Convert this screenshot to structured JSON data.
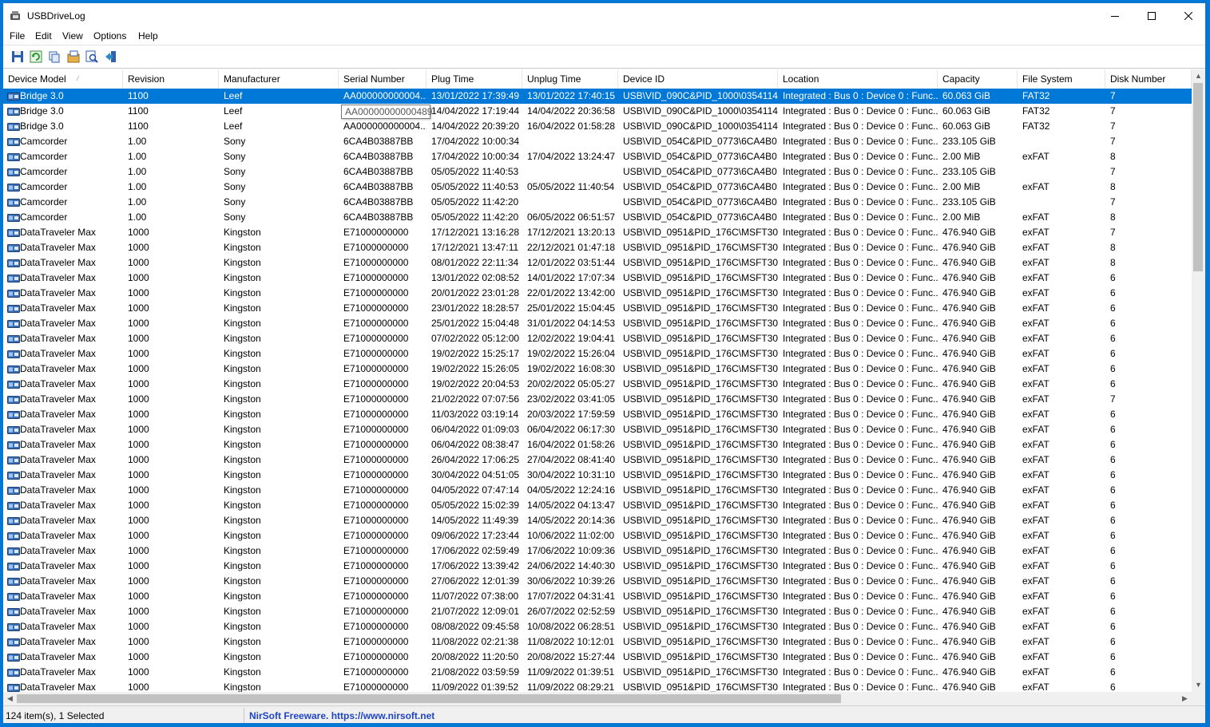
{
  "window": {
    "title": "USBDriveLog"
  },
  "menu": [
    "File",
    "Edit",
    "View",
    "Options",
    "Help"
  ],
  "toolbar": [
    "save-icon",
    "refresh-icon",
    "copy-icon",
    "properties-icon",
    "find-icon",
    "exit-icon"
  ],
  "columns": [
    "Device Model",
    "Revision",
    "Manufacturer",
    "Serial Number",
    "Plug Time",
    "Unplug Time",
    "Device ID",
    "Location",
    "Capacity",
    "File System",
    "Disk Number"
  ],
  "rows": [
    [
      "Bridge 3.0",
      "1100",
      "Leef",
      "AA000000000004...",
      "13/01/2022 17:39:49",
      "13/01/2022 17:40:15",
      "USB\\VID_090C&PID_1000\\0354114...",
      "Integrated : Bus 0 : Device 0 : Func...",
      "60.063 GiB",
      "FAT32",
      "7"
    ],
    [
      "Bridge 3.0",
      "1100",
      "Leef",
      "AA00000000000489",
      "14/04/2022 17:19:44",
      "14/04/2022 20:36:58",
      "USB\\VID_090C&PID_1000\\0354114...",
      "Integrated : Bus 0 : Device 0 : Func...",
      "60.063 GiB",
      "FAT32",
      "7"
    ],
    [
      "Bridge 3.0",
      "1100",
      "Leef",
      "AA000000000004...",
      "14/04/2022 20:39:20",
      "16/04/2022 01:58:28",
      "USB\\VID_090C&PID_1000\\0354114...",
      "Integrated : Bus 0 : Device 0 : Func...",
      "60.063 GiB",
      "FAT32",
      "7"
    ],
    [
      "Camcorder",
      "1.00",
      "Sony",
      "6CA4B03887BB",
      "17/04/2022 10:00:34",
      "",
      "USB\\VID_054C&PID_0773\\6CA4B0...",
      "Integrated : Bus 0 : Device 0 : Func...",
      "233.105 GiB",
      "",
      "7"
    ],
    [
      "Camcorder",
      "1.00",
      "Sony",
      "6CA4B03887BB",
      "17/04/2022 10:00:34",
      "17/04/2022 13:24:47",
      "USB\\VID_054C&PID_0773\\6CA4B0...",
      "Integrated : Bus 0 : Device 0 : Func...",
      "2.00 MiB",
      "exFAT",
      "8"
    ],
    [
      "Camcorder",
      "1.00",
      "Sony",
      "6CA4B03887BB",
      "05/05/2022 11:40:53",
      "",
      "USB\\VID_054C&PID_0773\\6CA4B0...",
      "Integrated : Bus 0 : Device 0 : Func...",
      "233.105 GiB",
      "",
      "7"
    ],
    [
      "Camcorder",
      "1.00",
      "Sony",
      "6CA4B03887BB",
      "05/05/2022 11:40:53",
      "05/05/2022 11:40:54",
      "USB\\VID_054C&PID_0773\\6CA4B0...",
      "Integrated : Bus 0 : Device 0 : Func...",
      "2.00 MiB",
      "exFAT",
      "8"
    ],
    [
      "Camcorder",
      "1.00",
      "Sony",
      "6CA4B03887BB",
      "05/05/2022 11:42:20",
      "",
      "USB\\VID_054C&PID_0773\\6CA4B0...",
      "Integrated : Bus 0 : Device 0 : Func...",
      "233.105 GiB",
      "",
      "7"
    ],
    [
      "Camcorder",
      "1.00",
      "Sony",
      "6CA4B03887BB",
      "05/05/2022 11:42:20",
      "06/05/2022 06:51:57",
      "USB\\VID_054C&PID_0773\\6CA4B0...",
      "Integrated : Bus 0 : Device 0 : Func...",
      "2.00 MiB",
      "exFAT",
      "8"
    ],
    [
      "DataTraveler Max",
      "1000",
      "Kingston",
      "E71000000000",
      "17/12/2021 13:16:28",
      "17/12/2021 13:20:13",
      "USB\\VID_0951&PID_176C\\MSFT30...",
      "Integrated : Bus 0 : Device 0 : Func...",
      "476.940 GiB",
      "exFAT",
      "7"
    ],
    [
      "DataTraveler Max",
      "1000",
      "Kingston",
      "E71000000000",
      "17/12/2021 13:47:11",
      "22/12/2021 01:47:18",
      "USB\\VID_0951&PID_176C\\MSFT30...",
      "Integrated : Bus 0 : Device 0 : Func...",
      "476.940 GiB",
      "exFAT",
      "8"
    ],
    [
      "DataTraveler Max",
      "1000",
      "Kingston",
      "E71000000000",
      "08/01/2022 22:11:34",
      "12/01/2022 03:51:44",
      "USB\\VID_0951&PID_176C\\MSFT30...",
      "Integrated : Bus 0 : Device 0 : Func...",
      "476.940 GiB",
      "exFAT",
      "8"
    ],
    [
      "DataTraveler Max",
      "1000",
      "Kingston",
      "E71000000000",
      "13/01/2022 02:08:52",
      "14/01/2022 17:07:34",
      "USB\\VID_0951&PID_176C\\MSFT30...",
      "Integrated : Bus 0 : Device 0 : Func...",
      "476.940 GiB",
      "exFAT",
      "6"
    ],
    [
      "DataTraveler Max",
      "1000",
      "Kingston",
      "E71000000000",
      "20/01/2022 23:01:28",
      "22/01/2022 13:42:00",
      "USB\\VID_0951&PID_176C\\MSFT30...",
      "Integrated : Bus 0 : Device 0 : Func...",
      "476.940 GiB",
      "exFAT",
      "6"
    ],
    [
      "DataTraveler Max",
      "1000",
      "Kingston",
      "E71000000000",
      "23/01/2022 18:28:57",
      "25/01/2022 15:04:45",
      "USB\\VID_0951&PID_176C\\MSFT30...",
      "Integrated : Bus 0 : Device 0 : Func...",
      "476.940 GiB",
      "exFAT",
      "6"
    ],
    [
      "DataTraveler Max",
      "1000",
      "Kingston",
      "E71000000000",
      "25/01/2022 15:04:48",
      "31/01/2022 04:14:53",
      "USB\\VID_0951&PID_176C\\MSFT30...",
      "Integrated : Bus 0 : Device 0 : Func...",
      "476.940 GiB",
      "exFAT",
      "6"
    ],
    [
      "DataTraveler Max",
      "1000",
      "Kingston",
      "E71000000000",
      "07/02/2022 05:12:00",
      "12/02/2022 19:04:41",
      "USB\\VID_0951&PID_176C\\MSFT30...",
      "Integrated : Bus 0 : Device 0 : Func...",
      "476.940 GiB",
      "exFAT",
      "6"
    ],
    [
      "DataTraveler Max",
      "1000",
      "Kingston",
      "E71000000000",
      "19/02/2022 15:25:17",
      "19/02/2022 15:26:04",
      "USB\\VID_0951&PID_176C\\MSFT30...",
      "Integrated : Bus 0 : Device 0 : Func...",
      "476.940 GiB",
      "exFAT",
      "6"
    ],
    [
      "DataTraveler Max",
      "1000",
      "Kingston",
      "E71000000000",
      "19/02/2022 15:26:05",
      "19/02/2022 16:08:30",
      "USB\\VID_0951&PID_176C\\MSFT30...",
      "Integrated : Bus 0 : Device 0 : Func...",
      "476.940 GiB",
      "exFAT",
      "6"
    ],
    [
      "DataTraveler Max",
      "1000",
      "Kingston",
      "E71000000000",
      "19/02/2022 20:04:53",
      "20/02/2022 05:05:27",
      "USB\\VID_0951&PID_176C\\MSFT30...",
      "Integrated : Bus 0 : Device 0 : Func...",
      "476.940 GiB",
      "exFAT",
      "6"
    ],
    [
      "DataTraveler Max",
      "1000",
      "Kingston",
      "E71000000000",
      "21/02/2022 07:07:56",
      "23/02/2022 03:41:05",
      "USB\\VID_0951&PID_176C\\MSFT30...",
      "Integrated : Bus 0 : Device 0 : Func...",
      "476.940 GiB",
      "exFAT",
      "7"
    ],
    [
      "DataTraveler Max",
      "1000",
      "Kingston",
      "E71000000000",
      "11/03/2022 03:19:14",
      "20/03/2022 17:59:59",
      "USB\\VID_0951&PID_176C\\MSFT30...",
      "Integrated : Bus 0 : Device 0 : Func...",
      "476.940 GiB",
      "exFAT",
      "6"
    ],
    [
      "DataTraveler Max",
      "1000",
      "Kingston",
      "E71000000000",
      "06/04/2022 01:09:03",
      "06/04/2022 06:17:30",
      "USB\\VID_0951&PID_176C\\MSFT30...",
      "Integrated : Bus 0 : Device 0 : Func...",
      "476.940 GiB",
      "exFAT",
      "6"
    ],
    [
      "DataTraveler Max",
      "1000",
      "Kingston",
      "E71000000000",
      "06/04/2022 08:38:47",
      "16/04/2022 01:58:26",
      "USB\\VID_0951&PID_176C\\MSFT30...",
      "Integrated : Bus 0 : Device 0 : Func...",
      "476.940 GiB",
      "exFAT",
      "6"
    ],
    [
      "DataTraveler Max",
      "1000",
      "Kingston",
      "E71000000000",
      "26/04/2022 17:06:25",
      "27/04/2022 08:41:40",
      "USB\\VID_0951&PID_176C\\MSFT30...",
      "Integrated : Bus 0 : Device 0 : Func...",
      "476.940 GiB",
      "exFAT",
      "6"
    ],
    [
      "DataTraveler Max",
      "1000",
      "Kingston",
      "E71000000000",
      "30/04/2022 04:51:05",
      "30/04/2022 10:31:10",
      "USB\\VID_0951&PID_176C\\MSFT30...",
      "Integrated : Bus 0 : Device 0 : Func...",
      "476.940 GiB",
      "exFAT",
      "6"
    ],
    [
      "DataTraveler Max",
      "1000",
      "Kingston",
      "E71000000000",
      "04/05/2022 07:47:14",
      "04/05/2022 12:24:16",
      "USB\\VID_0951&PID_176C\\MSFT30...",
      "Integrated : Bus 0 : Device 0 : Func...",
      "476.940 GiB",
      "exFAT",
      "6"
    ],
    [
      "DataTraveler Max",
      "1000",
      "Kingston",
      "E71000000000",
      "05/05/2022 15:02:39",
      "14/05/2022 04:13:47",
      "USB\\VID_0951&PID_176C\\MSFT30...",
      "Integrated : Bus 0 : Device 0 : Func...",
      "476.940 GiB",
      "exFAT",
      "6"
    ],
    [
      "DataTraveler Max",
      "1000",
      "Kingston",
      "E71000000000",
      "14/05/2022 11:49:39",
      "14/05/2022 20:14:36",
      "USB\\VID_0951&PID_176C\\MSFT30...",
      "Integrated : Bus 0 : Device 0 : Func...",
      "476.940 GiB",
      "exFAT",
      "6"
    ],
    [
      "DataTraveler Max",
      "1000",
      "Kingston",
      "E71000000000",
      "09/06/2022 17:23:44",
      "10/06/2022 11:02:00",
      "USB\\VID_0951&PID_176C\\MSFT30...",
      "Integrated : Bus 0 : Device 0 : Func...",
      "476.940 GiB",
      "exFAT",
      "6"
    ],
    [
      "DataTraveler Max",
      "1000",
      "Kingston",
      "E71000000000",
      "17/06/2022 02:59:49",
      "17/06/2022 10:09:36",
      "USB\\VID_0951&PID_176C\\MSFT30...",
      "Integrated : Bus 0 : Device 0 : Func...",
      "476.940 GiB",
      "exFAT",
      "6"
    ],
    [
      "DataTraveler Max",
      "1000",
      "Kingston",
      "E71000000000",
      "17/06/2022 13:39:42",
      "24/06/2022 14:40:30",
      "USB\\VID_0951&PID_176C\\MSFT30...",
      "Integrated : Bus 0 : Device 0 : Func...",
      "476.940 GiB",
      "exFAT",
      "6"
    ],
    [
      "DataTraveler Max",
      "1000",
      "Kingston",
      "E71000000000",
      "27/06/2022 12:01:39",
      "30/06/2022 10:39:26",
      "USB\\VID_0951&PID_176C\\MSFT30...",
      "Integrated : Bus 0 : Device 0 : Func...",
      "476.940 GiB",
      "exFAT",
      "6"
    ],
    [
      "DataTraveler Max",
      "1000",
      "Kingston",
      "E71000000000",
      "11/07/2022 07:38:00",
      "17/07/2022 04:31:41",
      "USB\\VID_0951&PID_176C\\MSFT30...",
      "Integrated : Bus 0 : Device 0 : Func...",
      "476.940 GiB",
      "exFAT",
      "6"
    ],
    [
      "DataTraveler Max",
      "1000",
      "Kingston",
      "E71000000000",
      "21/07/2022 12:09:01",
      "26/07/2022 02:52:59",
      "USB\\VID_0951&PID_176C\\MSFT30...",
      "Integrated : Bus 0 : Device 0 : Func...",
      "476.940 GiB",
      "exFAT",
      "6"
    ],
    [
      "DataTraveler Max",
      "1000",
      "Kingston",
      "E71000000000",
      "08/08/2022 09:45:58",
      "10/08/2022 06:28:51",
      "USB\\VID_0951&PID_176C\\MSFT30...",
      "Integrated : Bus 0 : Device 0 : Func...",
      "476.940 GiB",
      "exFAT",
      "6"
    ],
    [
      "DataTraveler Max",
      "1000",
      "Kingston",
      "E71000000000",
      "11/08/2022 02:21:38",
      "11/08/2022 10:12:01",
      "USB\\VID_0951&PID_176C\\MSFT30...",
      "Integrated : Bus 0 : Device 0 : Func...",
      "476.940 GiB",
      "exFAT",
      "6"
    ],
    [
      "DataTraveler Max",
      "1000",
      "Kingston",
      "E71000000000",
      "20/08/2022 11:20:50",
      "20/08/2022 15:27:44",
      "USB\\VID_0951&PID_176C\\MSFT30...",
      "Integrated : Bus 0 : Device 0 : Func...",
      "476.940 GiB",
      "exFAT",
      "6"
    ],
    [
      "DataTraveler Max",
      "1000",
      "Kingston",
      "E71000000000",
      "21/08/2022 03:59:59",
      "11/09/2022 01:39:51",
      "USB\\VID_0951&PID_176C\\MSFT30...",
      "Integrated : Bus 0 : Device 0 : Func...",
      "476.940 GiB",
      "exFAT",
      "6"
    ],
    [
      "DataTraveler Max",
      "1000",
      "Kingston",
      "E71000000000",
      "11/09/2022 01:39:52",
      "11/09/2022 08:29:21",
      "USB\\VID_0951&PID_176C\\MSFT30...",
      "Integrated : Bus 0 : Device 0 : Func...",
      "476.940 GiB",
      "exFAT",
      "6"
    ]
  ],
  "selected_row": 0,
  "tooltip": "AA00000000000489",
  "status": {
    "count": "124 item(s), 1 Selected",
    "credit": "NirSoft Freeware. https://www.nirsoft.net"
  },
  "colors": {
    "selection": "#0078d7",
    "desktop": "#0078d7",
    "credit_link": "#1f45c7"
  }
}
